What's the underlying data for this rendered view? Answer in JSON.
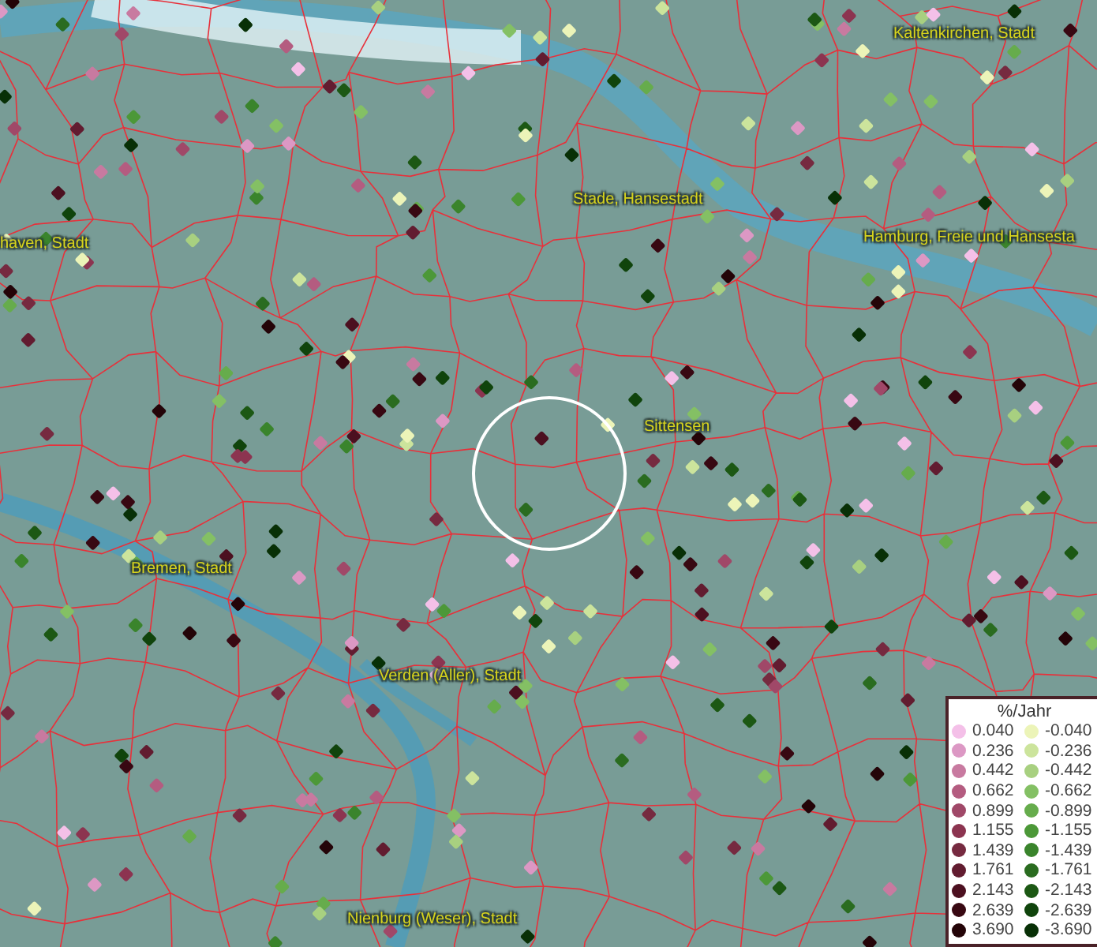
{
  "map": {
    "labels": [
      {
        "text": "Kaltenkirchen, Stadt"
      },
      {
        "text": "Stade, Hansestadt"
      },
      {
        "text": "haven, Stadt"
      },
      {
        "text": "Hamburg, Freie und Hansesta"
      },
      {
        "text": "Sittensen"
      },
      {
        "text": "Bremen, Stadt"
      },
      {
        "text": "Verden (Aller), Stadt"
      },
      {
        "text": "Nienburg (Weser), Stadt"
      }
    ]
  },
  "legend": {
    "title": "%/Jahr",
    "positive": [
      {
        "label": "0.040",
        "color": "#f4c0e8"
      },
      {
        "label": "0.236",
        "color": "#dc98c4"
      },
      {
        "label": "0.442",
        "color": "#c87aa0"
      },
      {
        "label": "0.662",
        "color": "#b45c80"
      },
      {
        "label": "0.899",
        "color": "#a04868"
      },
      {
        "label": "1.155",
        "color": "#8c3450"
      },
      {
        "label": "1.439",
        "color": "#762a40"
      },
      {
        "label": "1.761",
        "color": "#621c30"
      },
      {
        "label": "2.143",
        "color": "#4c1020"
      },
      {
        "label": "2.639",
        "color": "#380812"
      },
      {
        "label": "3.690",
        "color": "#240408"
      }
    ],
    "negative": [
      {
        "label": "-0.040",
        "color": "#ecf4b8"
      },
      {
        "label": "-0.236",
        "color": "#cce49c"
      },
      {
        "label": "-0.442",
        "color": "#a8d080"
      },
      {
        "label": "-0.662",
        "color": "#84c064"
      },
      {
        "label": "-0.899",
        "color": "#66ac4c"
      },
      {
        "label": "-1.155",
        "color": "#4c9838"
      },
      {
        "label": "-1.439",
        "color": "#3a842c"
      },
      {
        "label": "-1.761",
        "color": "#2a6c20"
      },
      {
        "label": "-2.143",
        "color": "#1c5814"
      },
      {
        "label": "-2.639",
        "color": "#10440c"
      },
      {
        "label": "-3.690",
        "color": "#083006"
      }
    ]
  }
}
